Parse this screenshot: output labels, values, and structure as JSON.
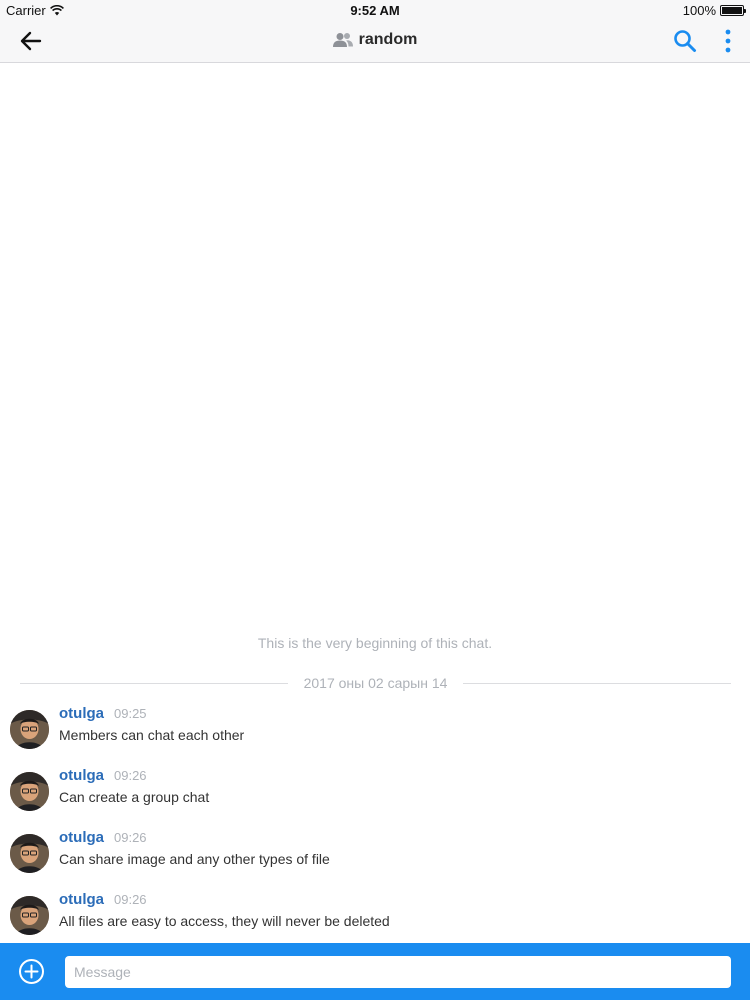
{
  "status_bar": {
    "carrier": "Carrier",
    "time": "9:52 AM",
    "battery": "100%",
    "battery_level": 1.0
  },
  "header": {
    "back_icon": "arrow-left-icon",
    "channel_icon": "group-icon",
    "title": "random",
    "search_icon": "search-icon",
    "more_icon": "more-vertical-icon"
  },
  "chat": {
    "beginning_note": "This is the very beginning of this chat.",
    "date_separator": "2017 оны 02 сарын 14",
    "messages": [
      {
        "username": "otulga",
        "time": "09:25",
        "text": "Members can chat each other"
      },
      {
        "username": "otulga",
        "time": "09:26",
        "text": "Can create a group chat"
      },
      {
        "username": "otulga",
        "time": "09:26",
        "text": "Can share image and any other types of file"
      },
      {
        "username": "otulga",
        "time": "09:26",
        "text": "All files are easy to access, they will never be deleted"
      }
    ]
  },
  "composer": {
    "add_icon": "plus-circle-icon",
    "placeholder": "Message"
  },
  "colors": {
    "accent": "#1a8cf0",
    "username": "#2b6cb8",
    "muted_text": "#aeb2b8"
  }
}
